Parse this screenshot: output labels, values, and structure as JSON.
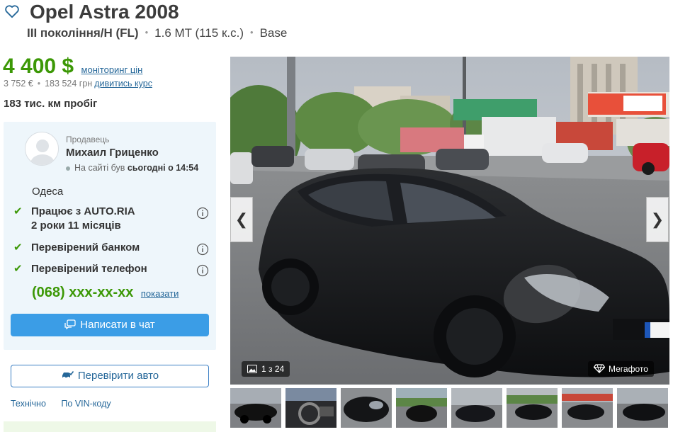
{
  "header": {
    "title": "Opel Astra 2008",
    "generation": "III покоління/H (FL)",
    "dot": "•",
    "engine": "1.6 MT (115 к.с.)",
    "trim": "Base"
  },
  "price": {
    "main": "4 400 $",
    "monitor_link": "моніторинг цін",
    "eur": "3 752  €",
    "dot": "•",
    "uah": "183 524  грн",
    "rate_link": "дивитись курс"
  },
  "mileage": "183 тис. км пробіг",
  "seller": {
    "label": "Продавець",
    "name": "Михаил Гриценко",
    "online_prefix": "На сайті був",
    "online_time": "сьогодні о 14:54",
    "city": "Одеса",
    "checks": [
      {
        "line1": "Працює з AUTO.RIA",
        "line2": "2 роки 11 місяців"
      },
      {
        "line1": "Перевірений банком"
      },
      {
        "line1": "Перевірений телефон"
      }
    ],
    "phone": "(068) xxx-xx-xx",
    "phone_show": "показати",
    "chat_button": "Написати в чат"
  },
  "check_auto_button": "Перевірити авто",
  "bottom_links": [
    "Технічно",
    "По VIN-коду"
  ],
  "gallery": {
    "prev": "❮",
    "next": "❯",
    "counter": "1 з 24",
    "megafoto": "Мегафото"
  },
  "colors": {
    "price_green": "#3c9806",
    "link_blue": "#256799",
    "button_blue": "#3b9de6",
    "card_bg": "#eef6fb"
  }
}
